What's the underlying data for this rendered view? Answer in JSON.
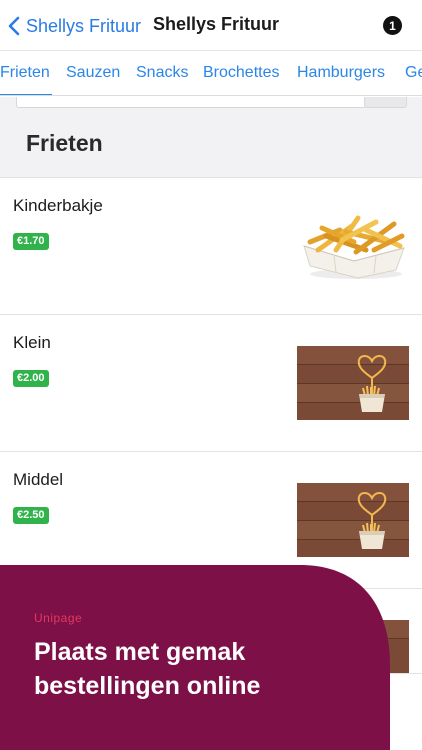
{
  "nav": {
    "back_label": "Shellys Frituur",
    "title": "Shellys Frituur",
    "badge": "1"
  },
  "tabs": [
    {
      "label": "Frieten",
      "active": true
    },
    {
      "label": "Sauzen",
      "active": false
    },
    {
      "label": "Snacks",
      "active": false
    },
    {
      "label": "Brochettes",
      "active": false
    },
    {
      "label": "Hamburgers",
      "active": false
    },
    {
      "label": "Ge",
      "active": false
    }
  ],
  "section": {
    "title": "Frieten"
  },
  "items": [
    {
      "name": "Kinderbakje",
      "price": "€1.70",
      "image": "fries-tray"
    },
    {
      "name": "Klein",
      "price": "€2.00",
      "image": "fries-heart-on-wood"
    },
    {
      "name": "Middel",
      "price": "€2.50",
      "image": "fries-heart-on-wood"
    }
  ],
  "promo": {
    "brand": "Unipage",
    "line1": "Plaats met gemak",
    "line2": "bestellingen online"
  },
  "colors": {
    "accent": "#2a86e8",
    "price_badge": "#2fb34a",
    "promo_background": "#7e1048",
    "promo_brand": "#e4375f"
  }
}
